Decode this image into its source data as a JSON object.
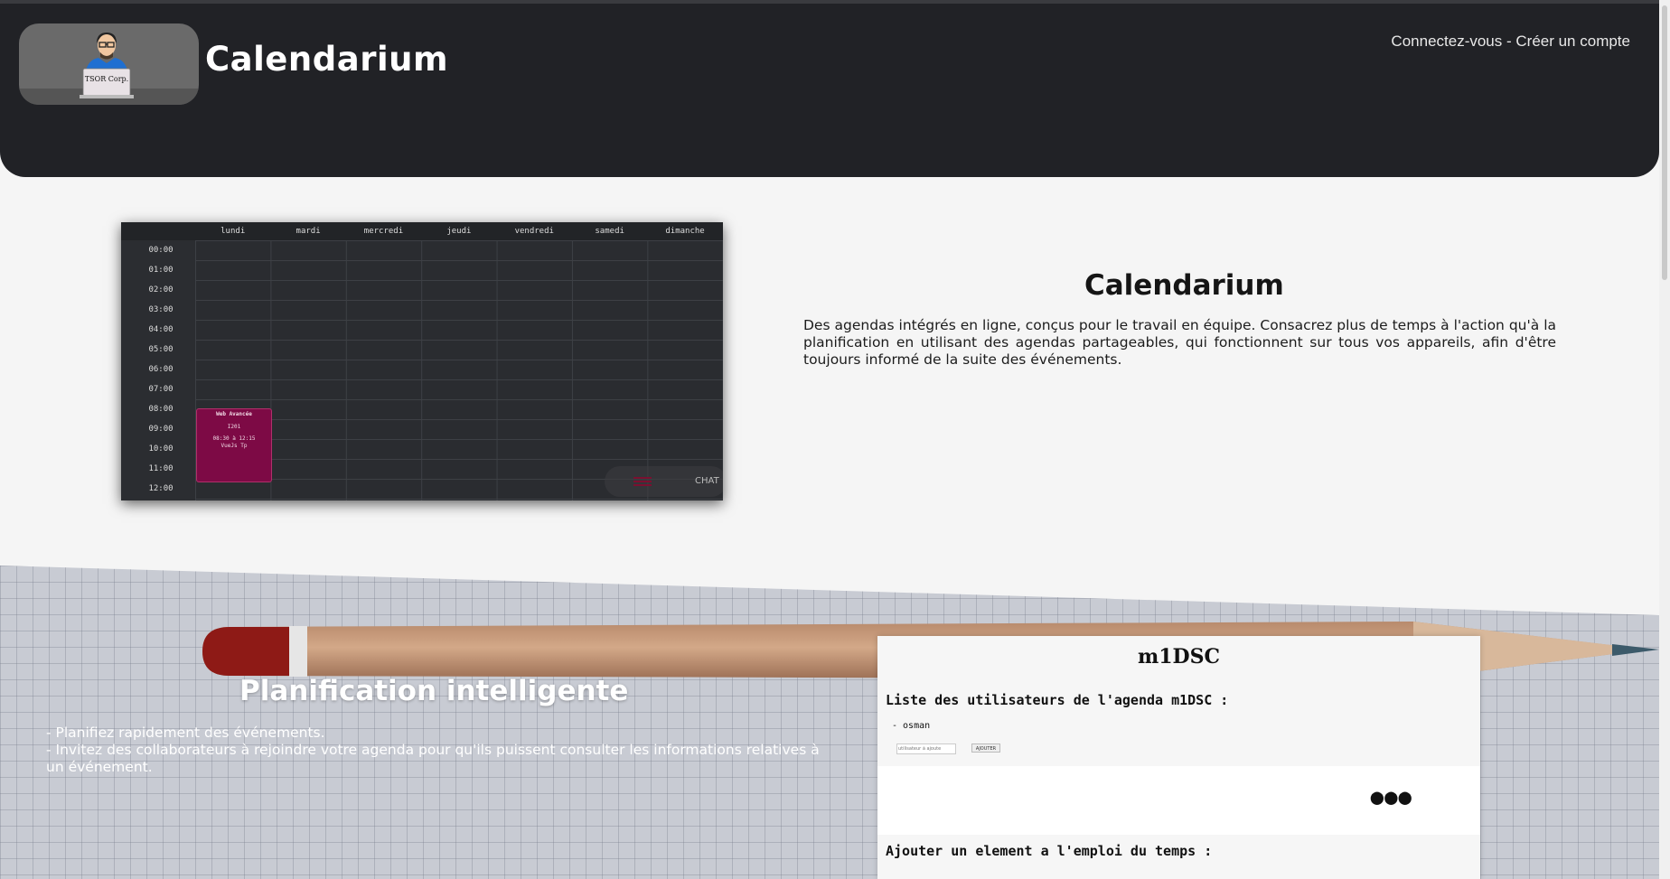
{
  "header": {
    "brand": "Calendarium",
    "logo_text": "TSOR Corp.",
    "auth": {
      "login": "Connectez-vous",
      "separator": " - ",
      "signup": "Créer un compte"
    }
  },
  "calendar": {
    "days": [
      "lundi",
      "mardi",
      "mercredi",
      "jeudi",
      "vendredi",
      "samedi",
      "dimanche"
    ],
    "hours": [
      "00:00",
      "01:00",
      "02:00",
      "03:00",
      "04:00",
      "05:00",
      "06:00",
      "07:00",
      "08:00",
      "09:00",
      "10:00",
      "11:00",
      "12:00"
    ],
    "event": {
      "title": "Web Avancée",
      "room": "I201",
      "time": "08:30 à 12:15",
      "note": "VueJs Tp"
    },
    "chat_label": "CHAT"
  },
  "hero": {
    "title": "Calendarium",
    "text": "Des agendas intégrés en ligne, conçus pour le travail en équipe. Consacrez plus de temps à l'action qu'à la planification en utilisant des agendas partageables, qui fonctionnent sur tous vos appareils, afin d'être toujours informé de la suite des événements."
  },
  "features": {
    "title": "Planification intelligente",
    "items": [
      "- Planifiez rapidement des événements.",
      "- Invitez des collaborateurs à rejoindre votre agenda pour qu'ils puissent consulter les informations relatives à un événement."
    ]
  },
  "panel": {
    "title": "m1DSC",
    "users_heading": "Liste des utilisateurs de l'agenda m1DSC :",
    "users": [
      "- osman"
    ],
    "input_placeholder": "utilisateur à ajoute",
    "add_button": "AJOUTER",
    "dots": "●●●",
    "add_element_heading": "Ajouter un element a l'emploi du temps :"
  },
  "colors": {
    "header_bg": "#212226",
    "page_bg": "#f5f5f5",
    "event_bg": "#7d0a45",
    "calendar_bg": "#222427"
  }
}
